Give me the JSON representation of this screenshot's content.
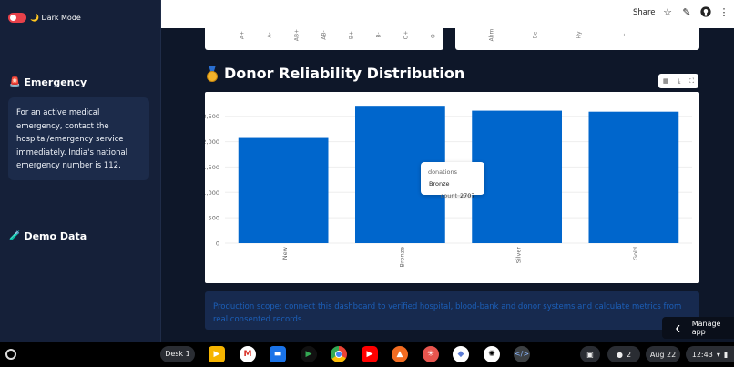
{
  "sidebar": {
    "dark_mode_label": "🌙 Dark Mode",
    "emergency_title": "Emergency",
    "emergency_text": "For an active medical emergency, contact the hospital/emergency service immediately. India's national emergency number is 112.",
    "demo_title": "Demo Data"
  },
  "header": {
    "share_label": "Share"
  },
  "prev_chart": {
    "left_ticks": [
      "A+",
      "A-",
      "AB+",
      "AB-",
      "B+",
      "B-",
      "O+",
      "O-"
    ],
    "right_ticks": [
      "Ahm",
      "Be",
      "Hy",
      "L"
    ]
  },
  "chart_section": {
    "title": "Donor Reliability Distribution"
  },
  "chart_data": {
    "type": "bar",
    "categories": [
      "New",
      "Bronze",
      "Silver",
      "Gold"
    ],
    "values": [
      2090,
      2707,
      2610,
      2590
    ],
    "ylim": [
      0,
      2800
    ],
    "yticks": [
      0,
      500,
      1000,
      1500,
      2000,
      2500
    ],
    "ytick_labels": [
      "0",
      "500",
      "1,000",
      "1,500",
      "2,000",
      "2,500"
    ],
    "bar_color": "#0066cc",
    "grid": true
  },
  "tooltip": {
    "key1": "donations",
    "val1": "Bronze",
    "key2": "count",
    "val2": "2707"
  },
  "info_box": {
    "text": "Production scope: connect this dashboard to verified hospital, blood-bank and donor systems and calculate metrics from real consented records."
  },
  "manage_app": {
    "label": "Manage app"
  },
  "taskbar": {
    "desk_label": "Desk 1",
    "notification_count": "2",
    "date": "Aug 22",
    "time": "12:43"
  }
}
